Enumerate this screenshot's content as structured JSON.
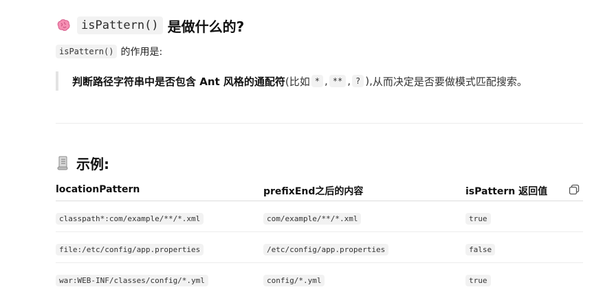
{
  "heading": {
    "icon": "brain-icon",
    "code": "isPattern()",
    "text": "是做什么的?"
  },
  "intro": {
    "code": "isPattern()",
    "text": "的作用是:"
  },
  "quote": {
    "bold": "判断路径字符串中是否包含 Ant 风格的通配符",
    "open": "(比如",
    "wildcards": [
      "*",
      "**",
      "?"
    ],
    "sep": ",",
    "close": "),",
    "tail": "从而决定是否要做模式匹配搜索。"
  },
  "section": {
    "icon": "scroll-icon",
    "title": "示例:"
  },
  "table": {
    "headers": [
      "locationPattern",
      "prefixEnd之后的内容",
      "isPattern 返回值"
    ],
    "copy_icon": "copy-icon",
    "rows": [
      [
        "classpath*:com/example/**/*.xml",
        "com/example/**/*.xml",
        "true"
      ],
      [
        "file:/etc/config/app.properties",
        "/etc/config/app.properties",
        "false"
      ],
      [
        "war:WEB-INF/classes/config/*.yml",
        "config/*.yml",
        "true"
      ]
    ]
  }
}
